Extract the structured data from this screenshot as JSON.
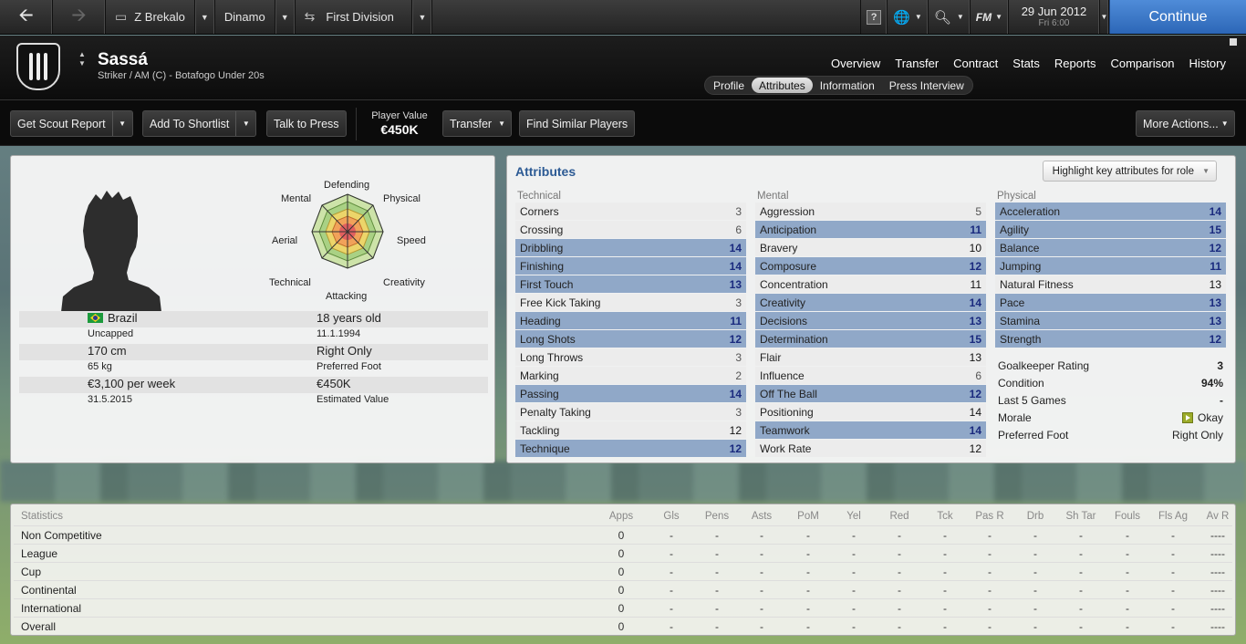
{
  "topbar": {
    "manager": "Z Brekalo",
    "club": "Dinamo",
    "league": "First Division",
    "help": "?",
    "fm": "FM",
    "date": "29 Jun 2012",
    "time": "Fri 6:00",
    "continue": "Continue"
  },
  "header": {
    "name": "Sassá",
    "position": "Striker / AM (C) - Botafogo Under 20s",
    "nav": [
      "Overview",
      "Transfer",
      "Contract",
      "Stats",
      "Reports",
      "Comparison",
      "History"
    ],
    "subtabs": [
      "Profile",
      "Attributes",
      "Information",
      "Press Interview"
    ],
    "active_subtab": "Attributes"
  },
  "toolbar": {
    "scout": "Get Scout Report",
    "shortlist": "Add To Shortlist",
    "press": "Talk to Press",
    "value_label": "Player Value",
    "value": "€450K",
    "transfer": "Transfer",
    "similar": "Find Similar Players",
    "more": "More Actions..."
  },
  "radar": {
    "labels": [
      "Defending",
      "Physical",
      "Speed",
      "Creativity",
      "Attacking",
      "Technical",
      "Aerial",
      "Mental"
    ]
  },
  "bio": {
    "nation": "Brazil",
    "caps": "Uncapped",
    "age": "18 years old",
    "dob": "11.1.1994",
    "height": "170 cm",
    "foot": "Right Only",
    "foot_label": "Preferred Foot",
    "weight": "65 kg",
    "wage": "€3,100 per week",
    "value": "€450K",
    "value_label": "Estimated Value",
    "contract": "31.5.2015"
  },
  "attributes": {
    "title": "Attributes",
    "highlight": "Highlight key attributes for role",
    "technical_label": "Technical",
    "mental_label": "Mental",
    "physical_label": "Physical",
    "technical": [
      [
        "Corners",
        "3",
        0
      ],
      [
        "Crossing",
        "6",
        0
      ],
      [
        "Dribbling",
        "14",
        1
      ],
      [
        "Finishing",
        "14",
        1
      ],
      [
        "First Touch",
        "13",
        1
      ],
      [
        "Free Kick Taking",
        "3",
        0
      ],
      [
        "Heading",
        "11",
        1
      ],
      [
        "Long Shots",
        "12",
        1
      ],
      [
        "Long Throws",
        "3",
        0
      ],
      [
        "Marking",
        "2",
        0
      ],
      [
        "Passing",
        "14",
        1
      ],
      [
        "Penalty Taking",
        "3",
        0
      ],
      [
        "Tackling",
        "12",
        0
      ],
      [
        "Technique",
        "12",
        1
      ]
    ],
    "mental": [
      [
        "Aggression",
        "5",
        0
      ],
      [
        "Anticipation",
        "11",
        1
      ],
      [
        "Bravery",
        "10",
        0
      ],
      [
        "Composure",
        "12",
        1
      ],
      [
        "Concentration",
        "11",
        0
      ],
      [
        "Creativity",
        "14",
        1
      ],
      [
        "Decisions",
        "13",
        1
      ],
      [
        "Determination",
        "15",
        1
      ],
      [
        "Flair",
        "13",
        0
      ],
      [
        "Influence",
        "6",
        0
      ],
      [
        "Off The Ball",
        "12",
        1
      ],
      [
        "Positioning",
        "14",
        0
      ],
      [
        "Teamwork",
        "14",
        1
      ],
      [
        "Work Rate",
        "12",
        0
      ]
    ],
    "physical": [
      [
        "Acceleration",
        "14",
        1
      ],
      [
        "Agility",
        "15",
        1
      ],
      [
        "Balance",
        "12",
        1
      ],
      [
        "Jumping",
        "11",
        1
      ],
      [
        "Natural Fitness",
        "13",
        0
      ],
      [
        "Pace",
        "13",
        1
      ],
      [
        "Stamina",
        "13",
        1
      ],
      [
        "Strength",
        "12",
        1
      ]
    ],
    "extra": [
      [
        "Goalkeeper Rating",
        "3"
      ],
      [
        "Condition",
        "94%"
      ],
      [
        "Last 5 Games",
        "-"
      ],
      [
        "Morale",
        "Okay"
      ],
      [
        "Preferred Foot",
        "Right Only"
      ]
    ]
  },
  "stats": {
    "title": "Statistics",
    "headers": [
      "Apps",
      "Gls",
      "Pens",
      "Asts",
      "PoM",
      "Yel",
      "Red",
      "Tck",
      "Pas R",
      "Drb",
      "Sh Tar",
      "Fouls",
      "Fls Ag",
      "Av R"
    ],
    "rows": [
      "Non Competitive",
      "League",
      "Cup",
      "Continental",
      "International",
      "Overall"
    ],
    "apps": "0",
    "dash": "-",
    "avr": "----"
  }
}
